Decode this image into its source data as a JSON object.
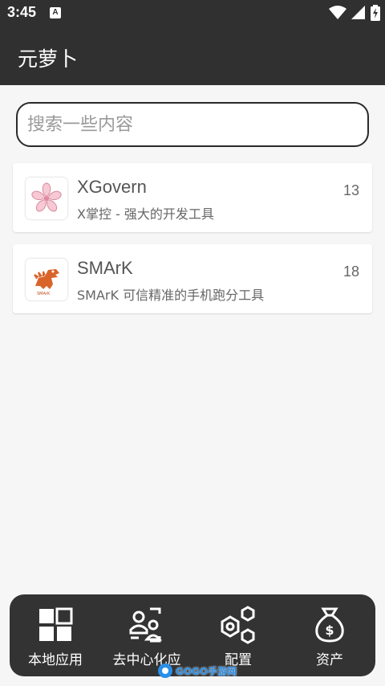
{
  "status_bar": {
    "time": "3:45",
    "notification_badge": "A",
    "icons": [
      "wifi-icon",
      "cell-signal-icon",
      "battery-charging-icon"
    ]
  },
  "header": {
    "title": "元萝卜"
  },
  "search": {
    "placeholder": "搜索一些内容",
    "value": ""
  },
  "apps": [
    {
      "name": "XGovern",
      "description": "X掌控 - 强大的开发工具",
      "count": "13",
      "icon": "sakura-flower-icon"
    },
    {
      "name": "SMArK",
      "description": "SMArK 可信精准的手机跑分工具",
      "count": "18",
      "icon": "dinosaur-icon"
    }
  ],
  "bottom_nav": {
    "items": [
      {
        "label": "本地应用",
        "icon": "grid-apps-icon"
      },
      {
        "label": "去中心化应",
        "icon": "decentralized-users-icon"
      },
      {
        "label": "配置",
        "icon": "hexagon-nodes-icon"
      },
      {
        "label": "资产",
        "icon": "money-bag-icon"
      }
    ]
  },
  "watermark": {
    "text": "GOGO手游网",
    "icon": "gogo-logo-icon"
  },
  "colors": {
    "header_bg": "#303030",
    "nav_bg": "#333333",
    "page_bg": "#f6f6f6",
    "watermark_blue": "#2a8fe8"
  }
}
